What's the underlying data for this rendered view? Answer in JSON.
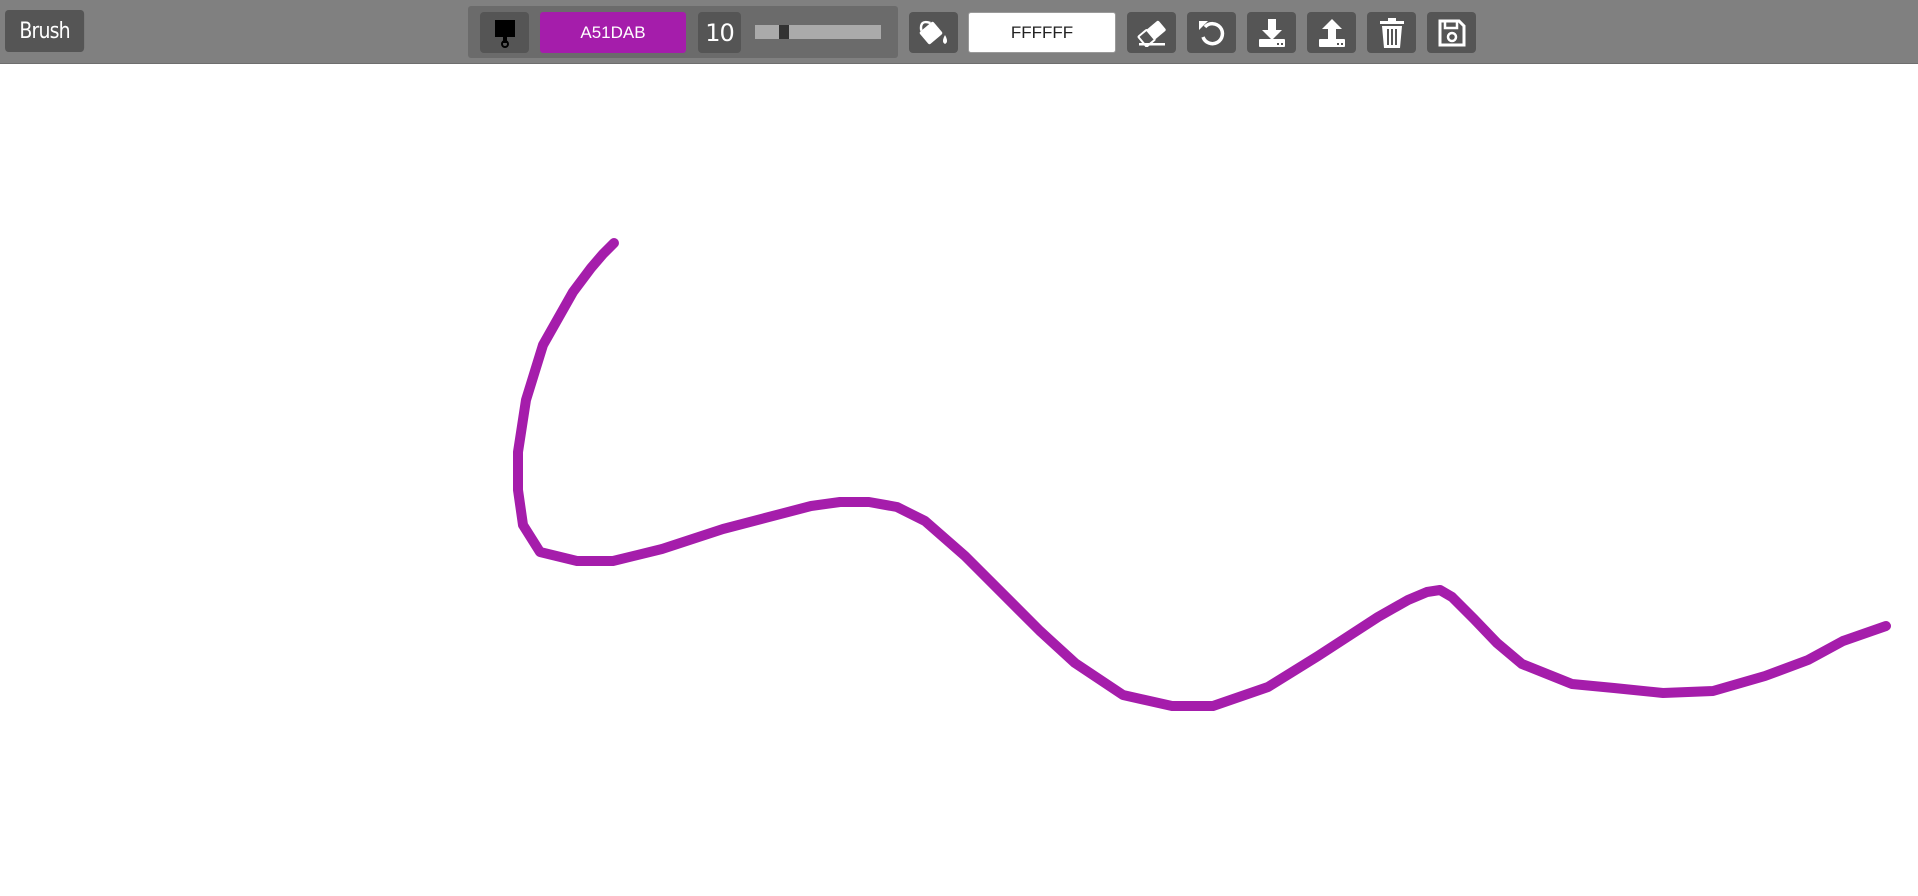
{
  "toolbar": {
    "mode_label": "Brush",
    "brush_color": "A51DAB",
    "brush_size": "10",
    "brush_size_level": 0.1,
    "background_color": "FFFFFF"
  },
  "colors": {
    "toolbar_bg": "#808080",
    "button_bg": "#555555",
    "stroke": "#A51DAB"
  },
  "icons": [
    "paint-brush-icon",
    "paint-bucket-icon",
    "eraser-icon",
    "undo-icon",
    "download-icon",
    "upload-icon",
    "trash-icon",
    "save-icon"
  ]
}
